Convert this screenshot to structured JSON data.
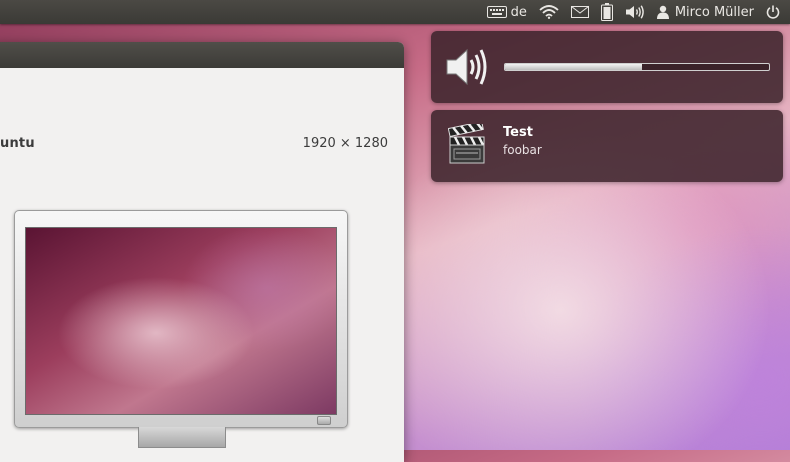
{
  "top_panel": {
    "keyboard_layout": "de",
    "user_name": "Mirco Müller",
    "indicators": [
      "keyboard-icon",
      "wifi-icon",
      "mail-icon",
      "battery-icon",
      "volume-icon",
      "user-icon",
      "power-icon"
    ]
  },
  "window": {
    "os_name": "untu",
    "resolution": "1920 × 1280"
  },
  "volume_bubble": {
    "icon": "speaker-icon",
    "level": 0.52
  },
  "notification": {
    "icon": "clapperboard-icon",
    "title": "Test",
    "body": "foobar"
  }
}
